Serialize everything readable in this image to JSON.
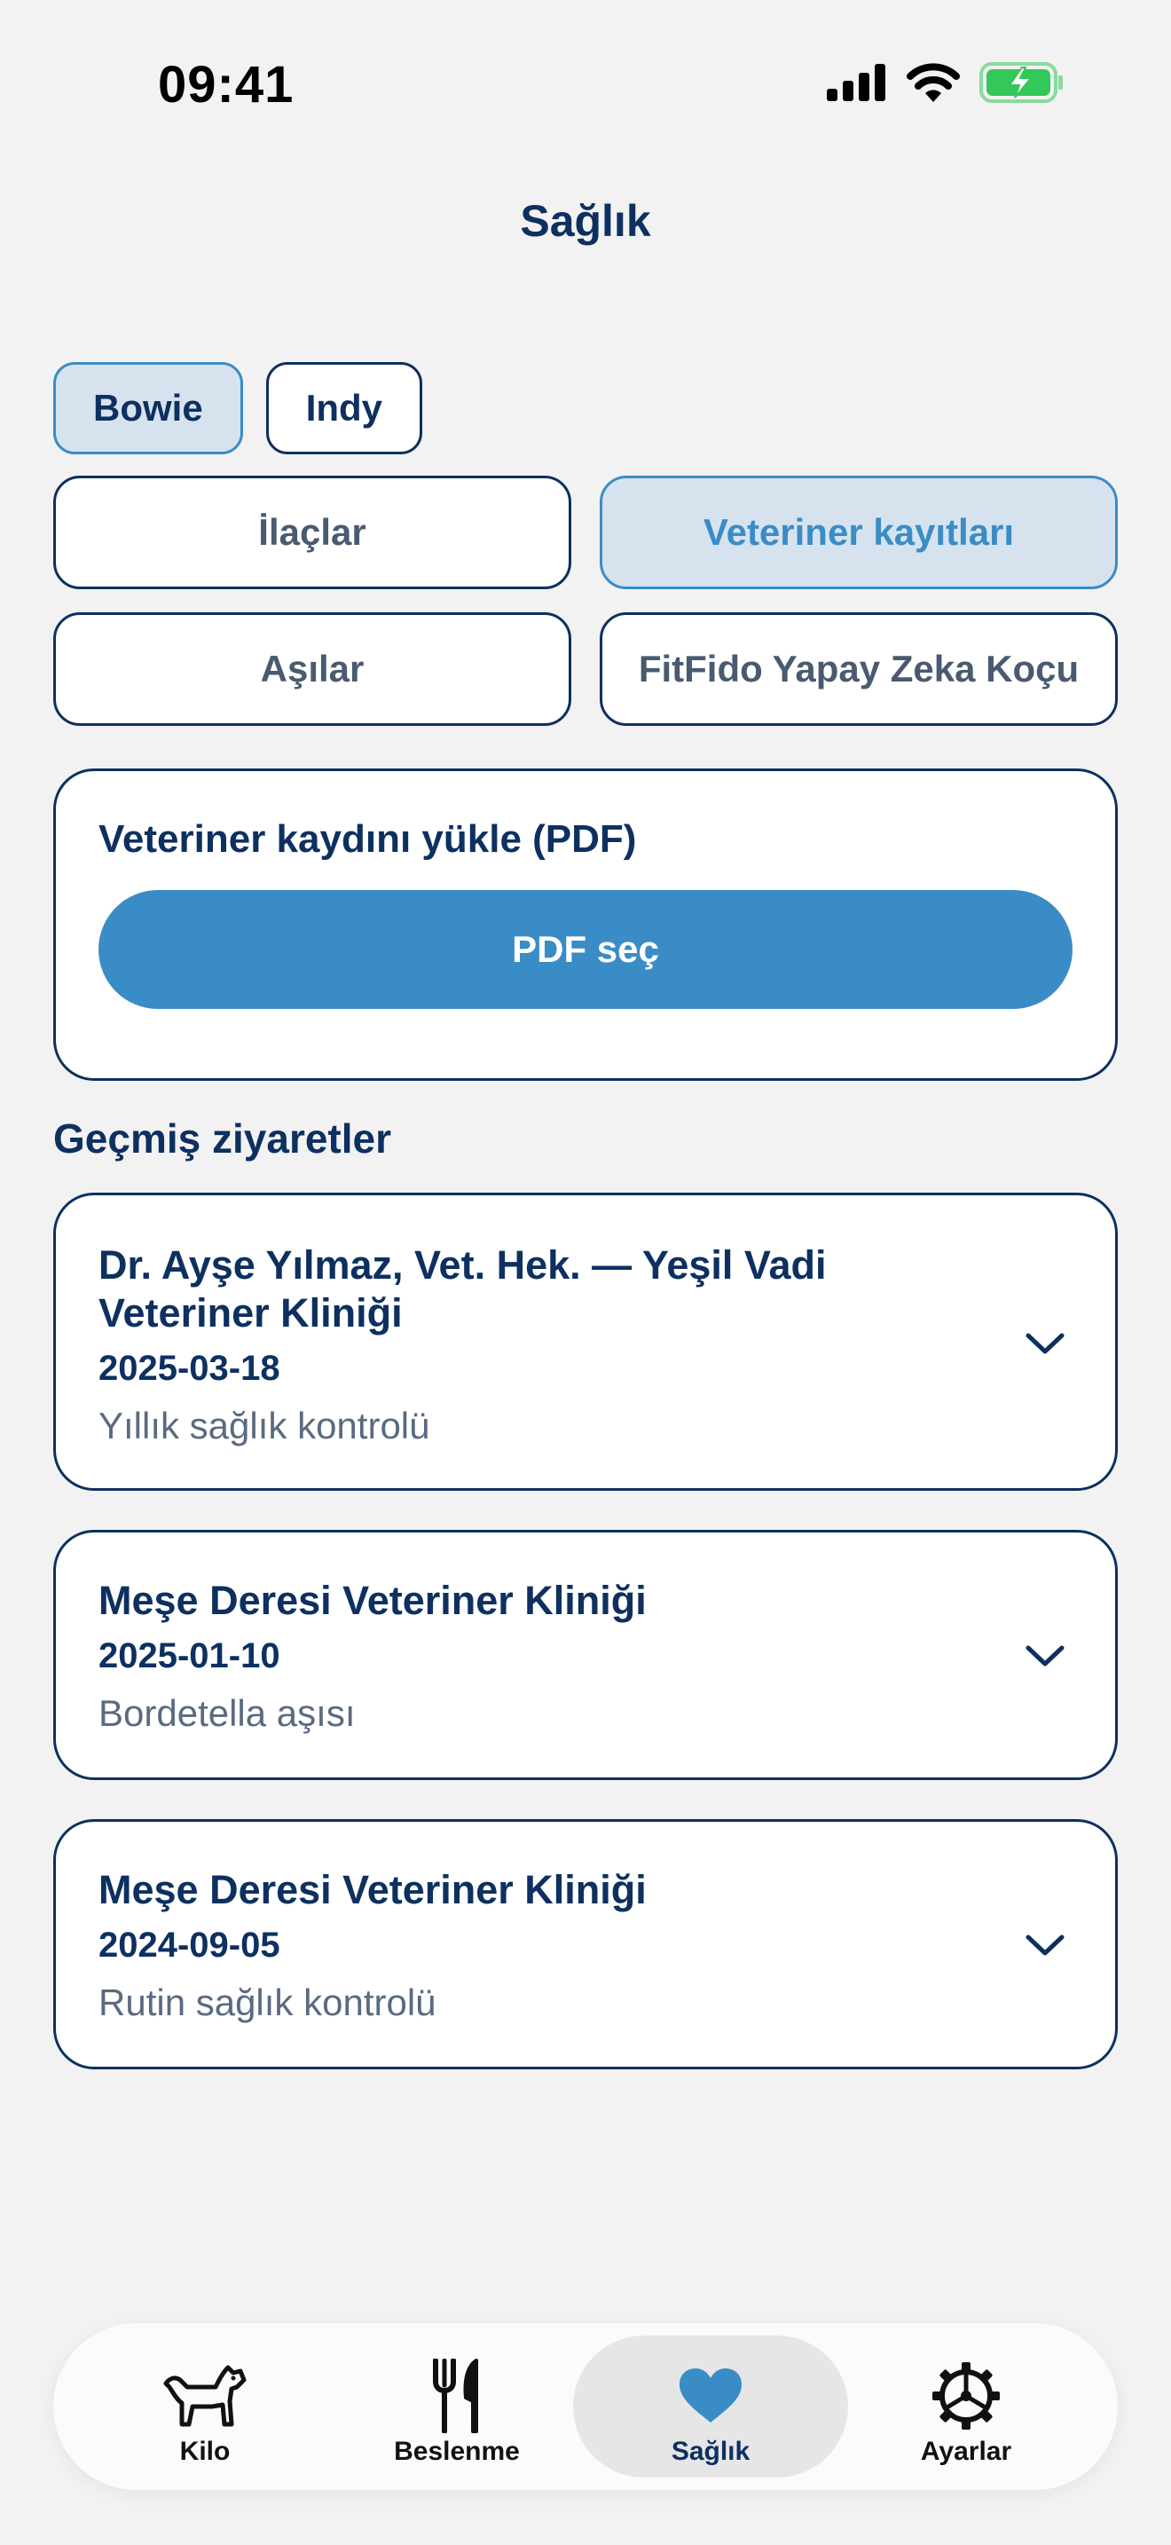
{
  "status_bar": {
    "time": "09:41"
  },
  "header": {
    "title": "Sağlık"
  },
  "pets": [
    {
      "label": "Bowie",
      "active": true
    },
    {
      "label": "Indy",
      "active": false
    }
  ],
  "segments": [
    {
      "label": "İlaçlar",
      "active": false
    },
    {
      "label": "Veteriner kayıtları",
      "active": true
    },
    {
      "label": "Aşılar",
      "active": false
    },
    {
      "label": "FitFido Yapay Zeka Koçu",
      "active": false
    }
  ],
  "upload": {
    "title": "Veteriner kaydını yükle (PDF)",
    "button_label": "PDF seç"
  },
  "history": {
    "title": "Geçmiş ziyaretler",
    "visits": [
      {
        "clinic": "Dr. Ayşe Yılmaz, Vet. Hek. — Yeşil Vadi Veteriner Kliniği",
        "date": "2025-03-18",
        "note": "Yıllık sağlık kontrolü"
      },
      {
        "clinic": "Meşe Deresi Veteriner Kliniği",
        "date": "2025-01-10",
        "note": "Bordetella aşısı"
      },
      {
        "clinic": "Meşe Deresi Veteriner Kliniği",
        "date": "2024-09-05",
        "note": "Rutin sağlık kontrolü"
      }
    ]
  },
  "tab_bar": {
    "tabs": [
      {
        "label": "Kilo",
        "icon": "dog-icon",
        "active": false
      },
      {
        "label": "Beslenme",
        "icon": "fork-knife-icon",
        "active": false
      },
      {
        "label": "Sağlık",
        "icon": "heart-icon",
        "active": true
      },
      {
        "label": "Ayarlar",
        "icon": "gear-icon",
        "active": false
      }
    ]
  },
  "colors": {
    "navy": "#0d3060",
    "accent": "#3a8cc6",
    "active_bg": "#d6e3ee",
    "background": "#f2f2f2",
    "battery": "#34c759"
  }
}
